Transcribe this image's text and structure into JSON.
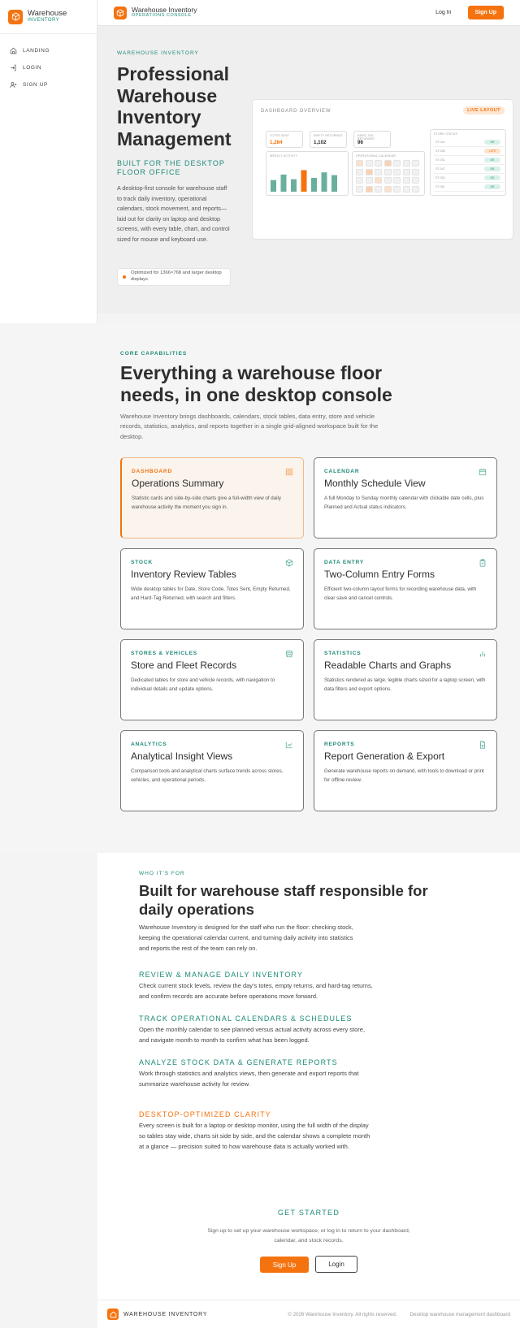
{
  "sidebar": {
    "brand_title": "Warehouse",
    "brand_sub": "INVENTORY",
    "items": [
      {
        "label": "LANDING",
        "icon": "home-icon"
      },
      {
        "label": "LOGIN",
        "icon": "login-icon"
      },
      {
        "label": "SIGN UP",
        "icon": "user-plus-icon"
      }
    ]
  },
  "topbar": {
    "title": "Warehouse Inventory",
    "subtitle": "OPERATIONS CONSOLE",
    "login_label": "Log In",
    "signup_label": "Sign Up"
  },
  "hero": {
    "eyebrow": "WAREHOUSE INVENTORY",
    "title": "Professional Warehouse Inventory Management",
    "subtitle": "BUILT FOR THE DESKTOP FLOOR OFFICE",
    "description": "A desktop-first console for warehouse staff to track daily inventory, operational calendars, stock movement, and reports—laid out for clarity on laptop and desktop screens, with every table, chart, and control sized for mouse and keyboard use.",
    "note": "Optimized for 1366×768 and larger desktop displays"
  },
  "dashboard_preview": {
    "title": "DASHBOARD OVERVIEW",
    "badge": "LIVE LAYOUT",
    "stats": [
      {
        "label": "TOTES SENT",
        "value": "1,284",
        "color": "#f5730f"
      },
      {
        "label": "EMPTY RETURNED",
        "value": "1,102",
        "color": "#2e2e2e"
      },
      {
        "label": "HARD-TAG RETURNED",
        "value": "96",
        "color": "#2e2e2e"
      }
    ],
    "chart_label": "WEEKLY ACTIVITY",
    "calendar_label": "OPERATIONAL CALENDAR",
    "status_label": "STORE STATUS",
    "bar_levels": [
      0.42,
      0.62,
      0.45,
      0.78,
      0.5,
      0.7,
      0.6
    ],
    "highlight_bar": 3,
    "statuses": [
      {
        "store": "ST-014",
        "status": "OK",
        "kind": "ok"
      },
      {
        "store": "ST-028",
        "status": "LATE",
        "kind": "late"
      },
      {
        "store": "ST-031",
        "status": "OK",
        "kind": "ok"
      },
      {
        "store": "ST-047",
        "status": "OK",
        "kind": "ok"
      },
      {
        "store": "ST-052",
        "status": "OK",
        "kind": "ok"
      },
      {
        "store": "ST-061",
        "status": "OK",
        "kind": "ok"
      }
    ]
  },
  "capabilities": {
    "eyebrow": "CORE CAPABILITIES",
    "title": "Everything a warehouse floor needs, in one desktop console",
    "description": "Warehouse Inventory brings dashboards, calendars, stock tables, data entry, store and vehicle records, statistics, analytics, and reports together in a single grid-aligned workspace built for the desktop.",
    "cards": [
      {
        "tag": "DASHBOARD",
        "title": "Operations Summary",
        "desc": "Statistic cards and side-by-side charts give a full-width view of daily warehouse activity the moment you sign in.",
        "icon": "grid-icon"
      },
      {
        "tag": "CALENDAR",
        "title": "Monthly Schedule View",
        "desc": "A full Monday to Sunday monthly calendar with clickable date cells, plus Planned and Actual status indicators.",
        "icon": "calendar-icon"
      },
      {
        "tag": "STOCK",
        "title": "Inventory Review Tables",
        "desc": "Wide desktop tables for Date, Store Code, Totes Sent, Empty Returned, and Hard-Tag Returned, with search and filters.",
        "icon": "box-icon"
      },
      {
        "tag": "DATA ENTRY",
        "title": "Two-Column Entry Forms",
        "desc": "Efficient two-column layout forms for recording warehouse data, with clear save and cancel controls.",
        "icon": "clipboard-icon"
      },
      {
        "tag": "STORES & VEHICLES",
        "title": "Store and Fleet Records",
        "desc": "Dedicated tables for store and vehicle records, with navigation to individual details and update options.",
        "icon": "store-icon"
      },
      {
        "tag": "STATISTICS",
        "title": "Readable Charts and Graphs",
        "desc": "Statistics rendered as large, legible charts sized for a laptop screen, with data filters and export options.",
        "icon": "bar-chart-icon"
      },
      {
        "tag": "ANALYTICS",
        "title": "Analytical Insight Views",
        "desc": "Comparison tools and analytical charts surface trends across stores, vehicles, and operational periods.",
        "icon": "line-chart-icon"
      },
      {
        "tag": "REPORTS",
        "title": "Report Generation & Export",
        "desc": "Generate warehouse reports on demand, with tools to download or print for offline review.",
        "icon": "document-icon"
      }
    ]
  },
  "who": {
    "eyebrow": "WHO IT'S FOR",
    "title": "Built for warehouse staff responsible for daily operations",
    "description": "Warehouse Inventory is designed for the staff who run the floor: checking stock, keeping the operational calendar current, and turning daily activity into statistics and reports the rest of the team can rely on.",
    "sections": [
      {
        "heading": "REVIEW & MANAGE DAILY INVENTORY",
        "text": "Check current stock levels, review the day's totes, empty returns, and hard-tag returns, and confirm records are accurate before operations move forward."
      },
      {
        "heading": "TRACK OPERATIONAL CALENDARS & SCHEDULES",
        "text": "Open the monthly calendar to see planned versus actual activity across every store, and navigate month to month to confirm what has been logged."
      },
      {
        "heading": "ANALYZE STOCK DATA & GENERATE REPORTS",
        "text": "Work through statistics and analytics views, then generate and export reports that summarize warehouse activity for review."
      },
      {
        "heading": "DESKTOP-OPTIMIZED CLARITY",
        "text": "Every screen is built for a laptop or desktop monitor, using the full width of the display so tables stay wide, charts sit side by side, and the calendar shows a complete month at a glance — precision suited to how warehouse data is actually worked with."
      }
    ]
  },
  "get_started": {
    "title": "GET STARTED",
    "description": "Sign up to set up your warehouse workspace, or log in to return to your dashboard, calendar, and stock records.",
    "signup_label": "Sign Up",
    "login_label": "Login"
  },
  "footer": {
    "name": "WAREHOUSE INVENTORY",
    "copyright": "© 2026 Warehouse Inventory. All rights reserved.",
    "tagline": "Desktop warehouse management dashboard"
  },
  "colors": {
    "accent": "#f5730f",
    "teal": "#1d8a78"
  }
}
